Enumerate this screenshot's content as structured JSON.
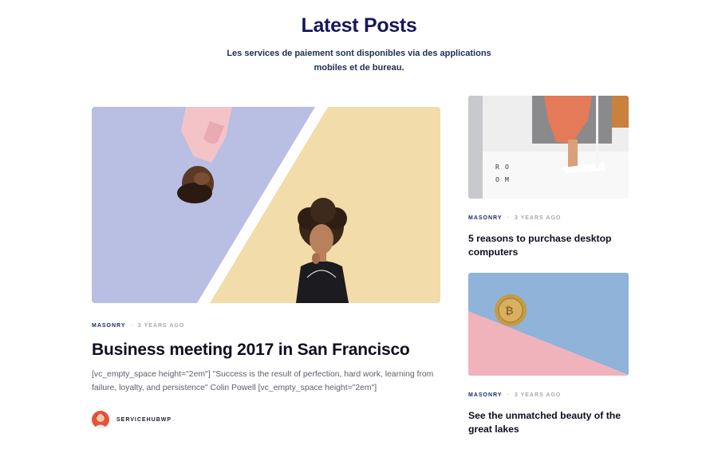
{
  "section": {
    "title": "Latest Posts",
    "subtitle": "Les services de paiement sont disponibles via des applications mobiles et de bureau."
  },
  "main_post": {
    "category": "MASONRY",
    "date": "3 YEARS AGO",
    "title": "Business meeting 2017 in San Francisco",
    "excerpt": "[vc_empty_space height=\"2em\"] \"Success is the result of perfection, hard work, learning from failure, loyalty, and persistence\" Colin Powell [vc_empty_space height=\"2em\"]",
    "author": "SERVICEHUBWP",
    "image_colors": {
      "left": "#b8bfe2",
      "right": "#f2ddaa"
    }
  },
  "side_posts": [
    {
      "category": "MASONRY",
      "date": "3 YEARS AGO",
      "title": "5 reasons to purchase desktop computers",
      "image_text": [
        "R",
        "O",
        "O",
        "M"
      ]
    },
    {
      "category": "MASONRY",
      "date": "3 YEARS AGO",
      "title": "See the unmatched beauty of the great lakes",
      "image_colors": {
        "top": "#8fb3d9",
        "bottom": "#f0b3bb"
      }
    }
  ],
  "colors": {
    "accent": "#17175c",
    "category": "#1d2a6b",
    "muted": "#a8a8b0"
  }
}
